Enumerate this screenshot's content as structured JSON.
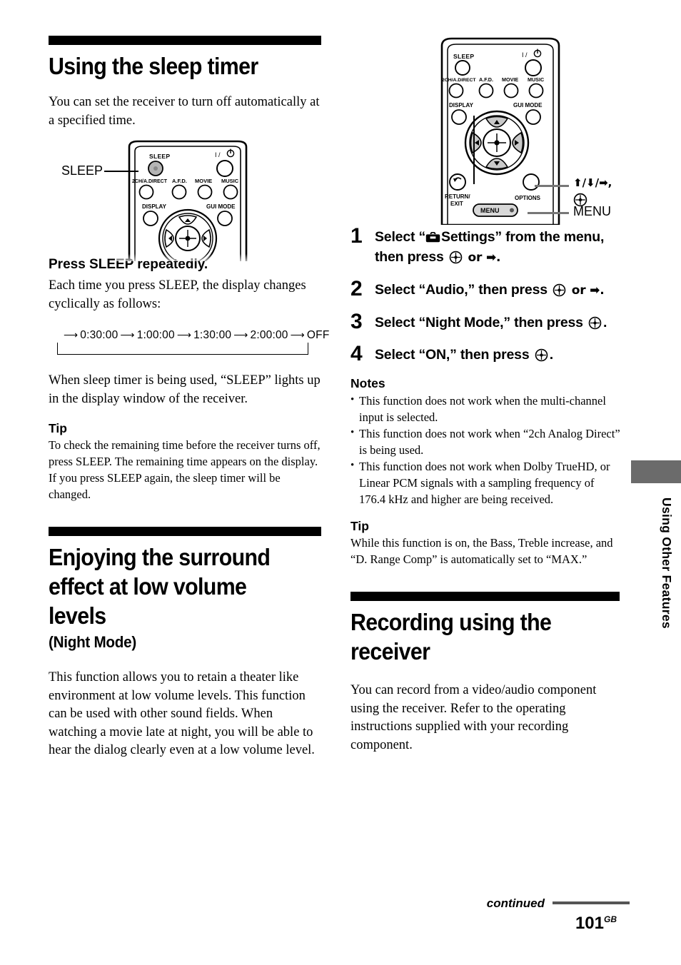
{
  "left_column": {
    "section1": {
      "title": "Using the sleep timer",
      "intro": "You can set the receiver to turn off automatically at a specified time.",
      "remote_callout": "SLEEP",
      "remote_buttons": {
        "sleep": "SLEEP",
        "power": "I / ⏻",
        "direct": "2CH/A.DIRECT",
        "afd": "A.F.D.",
        "movie": "MOVIE",
        "music": "MUSIC",
        "display": "DISPLAY",
        "gui_mode": "GUI MODE"
      },
      "instruction_head": "Press SLEEP repeatedly.",
      "instruction_body": "Each time you press SLEEP, the display changes cyclically as follows:",
      "cycle": [
        "0:30:00",
        "1:00:00",
        "1:30:00",
        "2:00:00",
        "OFF"
      ],
      "after_cycle": "When sleep timer is being used, “SLEEP” lights up in the display window of the receiver.",
      "tip_head": "Tip",
      "tip_body": "To check the remaining time before the receiver turns off, press SLEEP. The remaining time appears on the display. If you press SLEEP again, the sleep timer will be changed."
    },
    "section2": {
      "title": "Enjoying the surround effect at low volume levels",
      "subtitle": "(Night Mode)",
      "body": "This function allows you to retain a theater like environment at low volume levels. This function can be used with other sound fields. When watching a movie late at night, you will be able to hear the dialog clearly even at a low volume level."
    }
  },
  "right_column": {
    "remote_buttons": {
      "sleep": "SLEEP",
      "power": "I / ⏻",
      "direct": "2CH/A.DIRECT",
      "afd": "A.F.D.",
      "movie": "MOVIE",
      "music": "MUSIC",
      "display": "DISPLAY",
      "gui_mode": "GUI MODE",
      "return_exit_line1": "RETURN/",
      "return_exit_line2": "EXIT",
      "options": "OPTIONS",
      "menu": "MENU"
    },
    "callouts": {
      "arrows": "⬆/⬇/➡,",
      "menu": "MENU"
    },
    "steps": [
      {
        "num": "1",
        "text_before_icon": "Select “",
        "icon": "toolbox-icon",
        "text_after_icon": "Settings” from the menu, then press ",
        "text_tail": " or ➡."
      },
      {
        "num": "2",
        "text_before_icon": "Select “Audio,” then press ",
        "text_tail": " or ➡."
      },
      {
        "num": "3",
        "text_before_icon": "Select “Night Mode,” then press ",
        "text_tail": "."
      },
      {
        "num": "4",
        "text_before_icon": "Select “ON,” then press ",
        "text_tail": "."
      }
    ],
    "notes_head": "Notes",
    "notes": [
      "This function does not work when the multi-channel input is selected.",
      "This function does not work when “2ch Analog Direct” is being used.",
      "This function does not work when Dolby TrueHD, or Linear PCM signals with a sampling frequency of 176.4 kHz and higher are being received."
    ],
    "tip_head": "Tip",
    "tip_body": "While this function is on, the Bass, Treble increase, and “D. Range Comp” is automatically set to “MAX.”",
    "section3": {
      "title": "Recording using the receiver",
      "body": "You can record from a video/audio component using the receiver. Refer to the operating instructions supplied with your recording component."
    }
  },
  "side_tab": {
    "label": "Using Other Features"
  },
  "footer": {
    "continued": "continued",
    "page_number": "101",
    "page_suffix": "GB"
  },
  "colors": {
    "rule": "#000000",
    "side_tab_block": "#6b6b6b",
    "footer_rule": "#555555",
    "button_fill": "#c9c9c9"
  }
}
